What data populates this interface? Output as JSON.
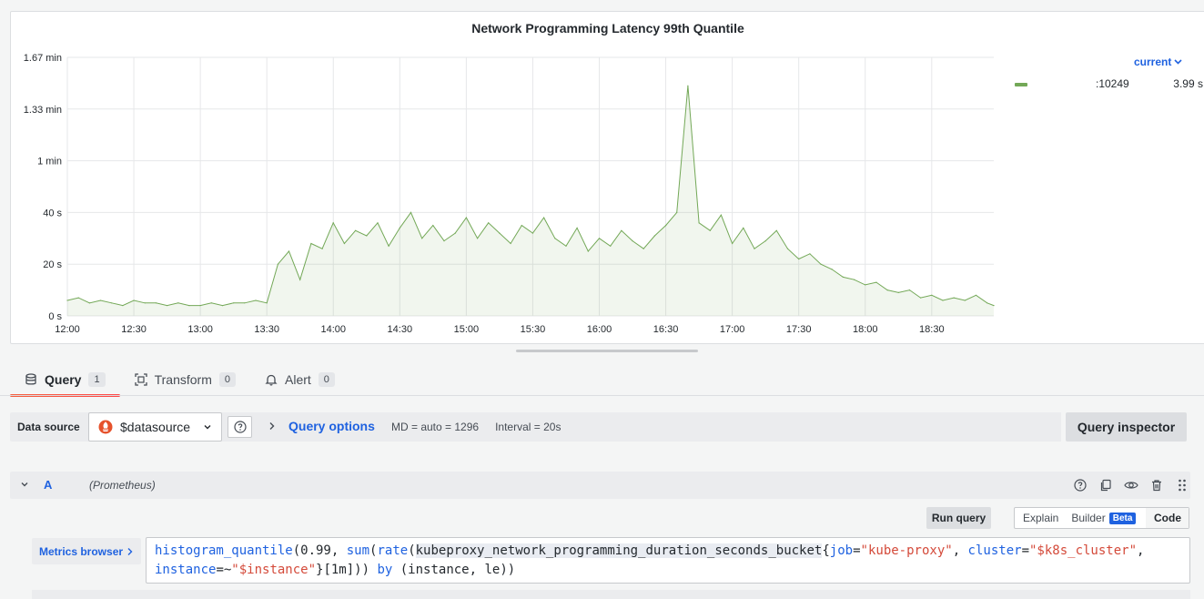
{
  "panel": {
    "title": "Network Programming Latency 99th Quantile",
    "legend": {
      "sort_label": "current",
      "series_name": ":10249",
      "series_value": "3.99 s",
      "series_color": "#73a857"
    }
  },
  "chart_data": {
    "type": "area",
    "title": "Network Programming Latency 99th Quantile",
    "xlabel": "",
    "ylabel": "",
    "x_ticks": [
      "12:00",
      "12:30",
      "13:00",
      "13:30",
      "14:00",
      "14:30",
      "15:00",
      "15:30",
      "16:00",
      "16:30",
      "17:00",
      "17:30",
      "18:00",
      "18:30"
    ],
    "y_ticks": [
      "0 s",
      "20 s",
      "40 s",
      "1 min",
      "1.33 min",
      "1.67 min"
    ],
    "ylim": [
      0,
      100
    ],
    "xlim": [
      "12:00",
      "18:58"
    ],
    "grid": true,
    "legend_position": "right",
    "series": [
      {
        "name": ":10249",
        "color": "#73a857",
        "current": 3.99,
        "points": [
          [
            "12:00",
            6
          ],
          [
            "12:05",
            7
          ],
          [
            "12:10",
            5
          ],
          [
            "12:15",
            6
          ],
          [
            "12:20",
            5
          ],
          [
            "12:25",
            4
          ],
          [
            "12:30",
            6
          ],
          [
            "12:35",
            5
          ],
          [
            "12:40",
            5
          ],
          [
            "12:45",
            4
          ],
          [
            "12:50",
            5
          ],
          [
            "12:55",
            4
          ],
          [
            "13:00",
            4
          ],
          [
            "13:05",
            5
          ],
          [
            "13:10",
            4
          ],
          [
            "13:15",
            5
          ],
          [
            "13:20",
            5
          ],
          [
            "13:25",
            6
          ],
          [
            "13:30",
            5
          ],
          [
            "13:35",
            20
          ],
          [
            "13:40",
            25
          ],
          [
            "13:45",
            14
          ],
          [
            "13:50",
            28
          ],
          [
            "13:55",
            26
          ],
          [
            "14:00",
            36
          ],
          [
            "14:05",
            28
          ],
          [
            "14:10",
            33
          ],
          [
            "14:15",
            31
          ],
          [
            "14:20",
            36
          ],
          [
            "14:25",
            27
          ],
          [
            "14:30",
            34
          ],
          [
            "14:35",
            40
          ],
          [
            "14:40",
            30
          ],
          [
            "14:45",
            35
          ],
          [
            "14:50",
            29
          ],
          [
            "14:55",
            32
          ],
          [
            "15:00",
            38
          ],
          [
            "15:05",
            30
          ],
          [
            "15:10",
            36
          ],
          [
            "15:15",
            32
          ],
          [
            "15:20",
            28
          ],
          [
            "15:25",
            35
          ],
          [
            "15:30",
            32
          ],
          [
            "15:35",
            38
          ],
          [
            "15:40",
            30
          ],
          [
            "15:45",
            27
          ],
          [
            "15:50",
            34
          ],
          [
            "15:55",
            25
          ],
          [
            "16:00",
            30
          ],
          [
            "16:05",
            27
          ],
          [
            "16:10",
            33
          ],
          [
            "16:15",
            29
          ],
          [
            "16:20",
            26
          ],
          [
            "16:25",
            31
          ],
          [
            "16:30",
            35
          ],
          [
            "16:35",
            40
          ],
          [
            "16:40",
            89
          ],
          [
            "16:45",
            36
          ],
          [
            "16:50",
            33
          ],
          [
            "16:55",
            39
          ],
          [
            "17:00",
            28
          ],
          [
            "17:05",
            34
          ],
          [
            "17:10",
            26
          ],
          [
            "17:15",
            29
          ],
          [
            "17:20",
            33
          ],
          [
            "17:25",
            26
          ],
          [
            "17:30",
            22
          ],
          [
            "17:35",
            24
          ],
          [
            "17:40",
            20
          ],
          [
            "17:45",
            18
          ],
          [
            "17:50",
            15
          ],
          [
            "17:55",
            14
          ],
          [
            "18:00",
            12
          ],
          [
            "18:05",
            13
          ],
          [
            "18:10",
            10
          ],
          [
            "18:15",
            9
          ],
          [
            "18:20",
            10
          ],
          [
            "18:25",
            7
          ],
          [
            "18:30",
            8
          ],
          [
            "18:35",
            6
          ],
          [
            "18:40",
            7
          ],
          [
            "18:45",
            6
          ],
          [
            "18:50",
            8
          ],
          [
            "18:55",
            5
          ],
          [
            "18:58",
            4
          ]
        ]
      }
    ]
  },
  "tabs": [
    {
      "label": "Query",
      "count": "1",
      "icon": "database-icon"
    },
    {
      "label": "Transform",
      "count": "0",
      "icon": "transform-icon"
    },
    {
      "label": "Alert",
      "count": "0",
      "icon": "bell-icon"
    }
  ],
  "query_bar": {
    "datasource_label": "Data source",
    "datasource_value": "$datasource",
    "query_options_label": "Query options",
    "md": "MD = auto = 1296",
    "interval": "Interval = 20s",
    "inspector_label": "Query inspector"
  },
  "query_row": {
    "ref": "A",
    "datasource": "(Prometheus)",
    "run_label": "Run query",
    "modes": {
      "explain": "Explain",
      "builder": "Builder",
      "beta": "Beta",
      "code": "Code"
    },
    "metrics_browser": "Metrics browser",
    "expr": {
      "fn1": "histogram_quantile",
      "p1": "(0.99, ",
      "fn2": "sum",
      "p2": "(",
      "fn3": "rate",
      "p3": "(",
      "metric": "kubeproxy_network_programming_duration_seconds_bucket",
      "p4": "{",
      "l1": "job",
      "op1": "=",
      "v1": "\"kube-proxy\"",
      "sep1": ", ",
      "l2": "cluster",
      "op2": "=",
      "v2": "\"$k8s_cluster\"",
      "sep2": ",",
      "l3": "instance",
      "op3": "=~",
      "v3": "\"$instance\"",
      "p5": "}[1m])) ",
      "kw": "by",
      "p6": " (instance, le))"
    }
  }
}
